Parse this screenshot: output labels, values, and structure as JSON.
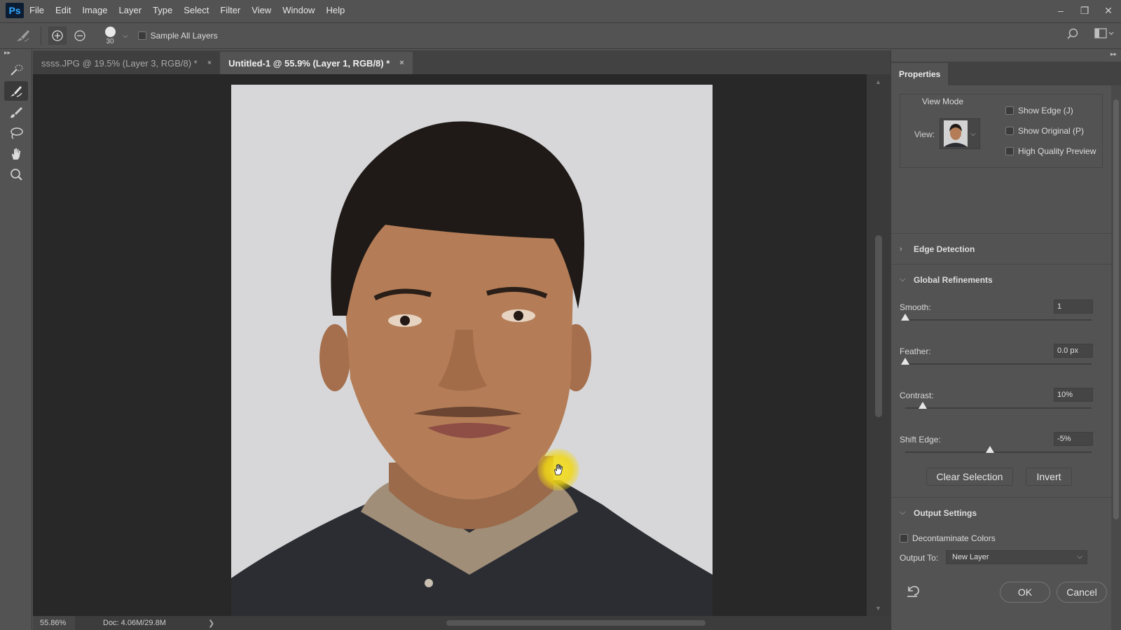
{
  "app": {
    "logo": "Ps"
  },
  "menu": [
    "File",
    "Edit",
    "Image",
    "Layer",
    "Type",
    "Select",
    "Filter",
    "View",
    "Window",
    "Help"
  ],
  "window_controls": {
    "minimize": "–",
    "restore": "❐",
    "close": "✕"
  },
  "options": {
    "brush_size": "30",
    "sample_all_layers_label": "Sample All Layers",
    "sample_all_layers_checked": false
  },
  "tabs": [
    {
      "label": "ssss.JPG @ 19.5% (Layer 3, RGB/8) *",
      "active": false
    },
    {
      "label": "Untitled-1 @ 55.9% (Layer 1, RGB/8) *",
      "active": true
    }
  ],
  "tab_close": "×",
  "status": {
    "zoom": "55.86%",
    "doc": "Doc: 4.06M/29.8M",
    "arrow": "❯"
  },
  "panel": {
    "tab": "Properties",
    "view_mode": {
      "title": "View Mode",
      "view_label": "View:",
      "show_edge": "Show Edge (J)",
      "show_original": "Show Original (P)",
      "high_quality": "High Quality Preview"
    },
    "edge_detection": "Edge Detection",
    "global_refinements": "Global Refinements",
    "smooth": {
      "label": "Smooth:",
      "value": "1",
      "level": 0
    },
    "feather": {
      "label": "Feather:",
      "value": "0.0 px",
      "level": 0
    },
    "contrast": {
      "label": "Contrast:",
      "value": "10%",
      "level": 0.1
    },
    "shift_edge": {
      "label": "Shift Edge:",
      "value": "-5%",
      "level": 0.475
    },
    "clear_selection": "Clear Selection",
    "invert": "Invert",
    "output_settings": "Output Settings",
    "decontaminate": "Decontaminate Colors",
    "output_to_label": "Output To:",
    "output_to_value": "New Layer",
    "ok": "OK",
    "cancel": "Cancel"
  },
  "colors": {
    "accent": "#31a8ff",
    "cursor_highlight": "#f2d820"
  }
}
